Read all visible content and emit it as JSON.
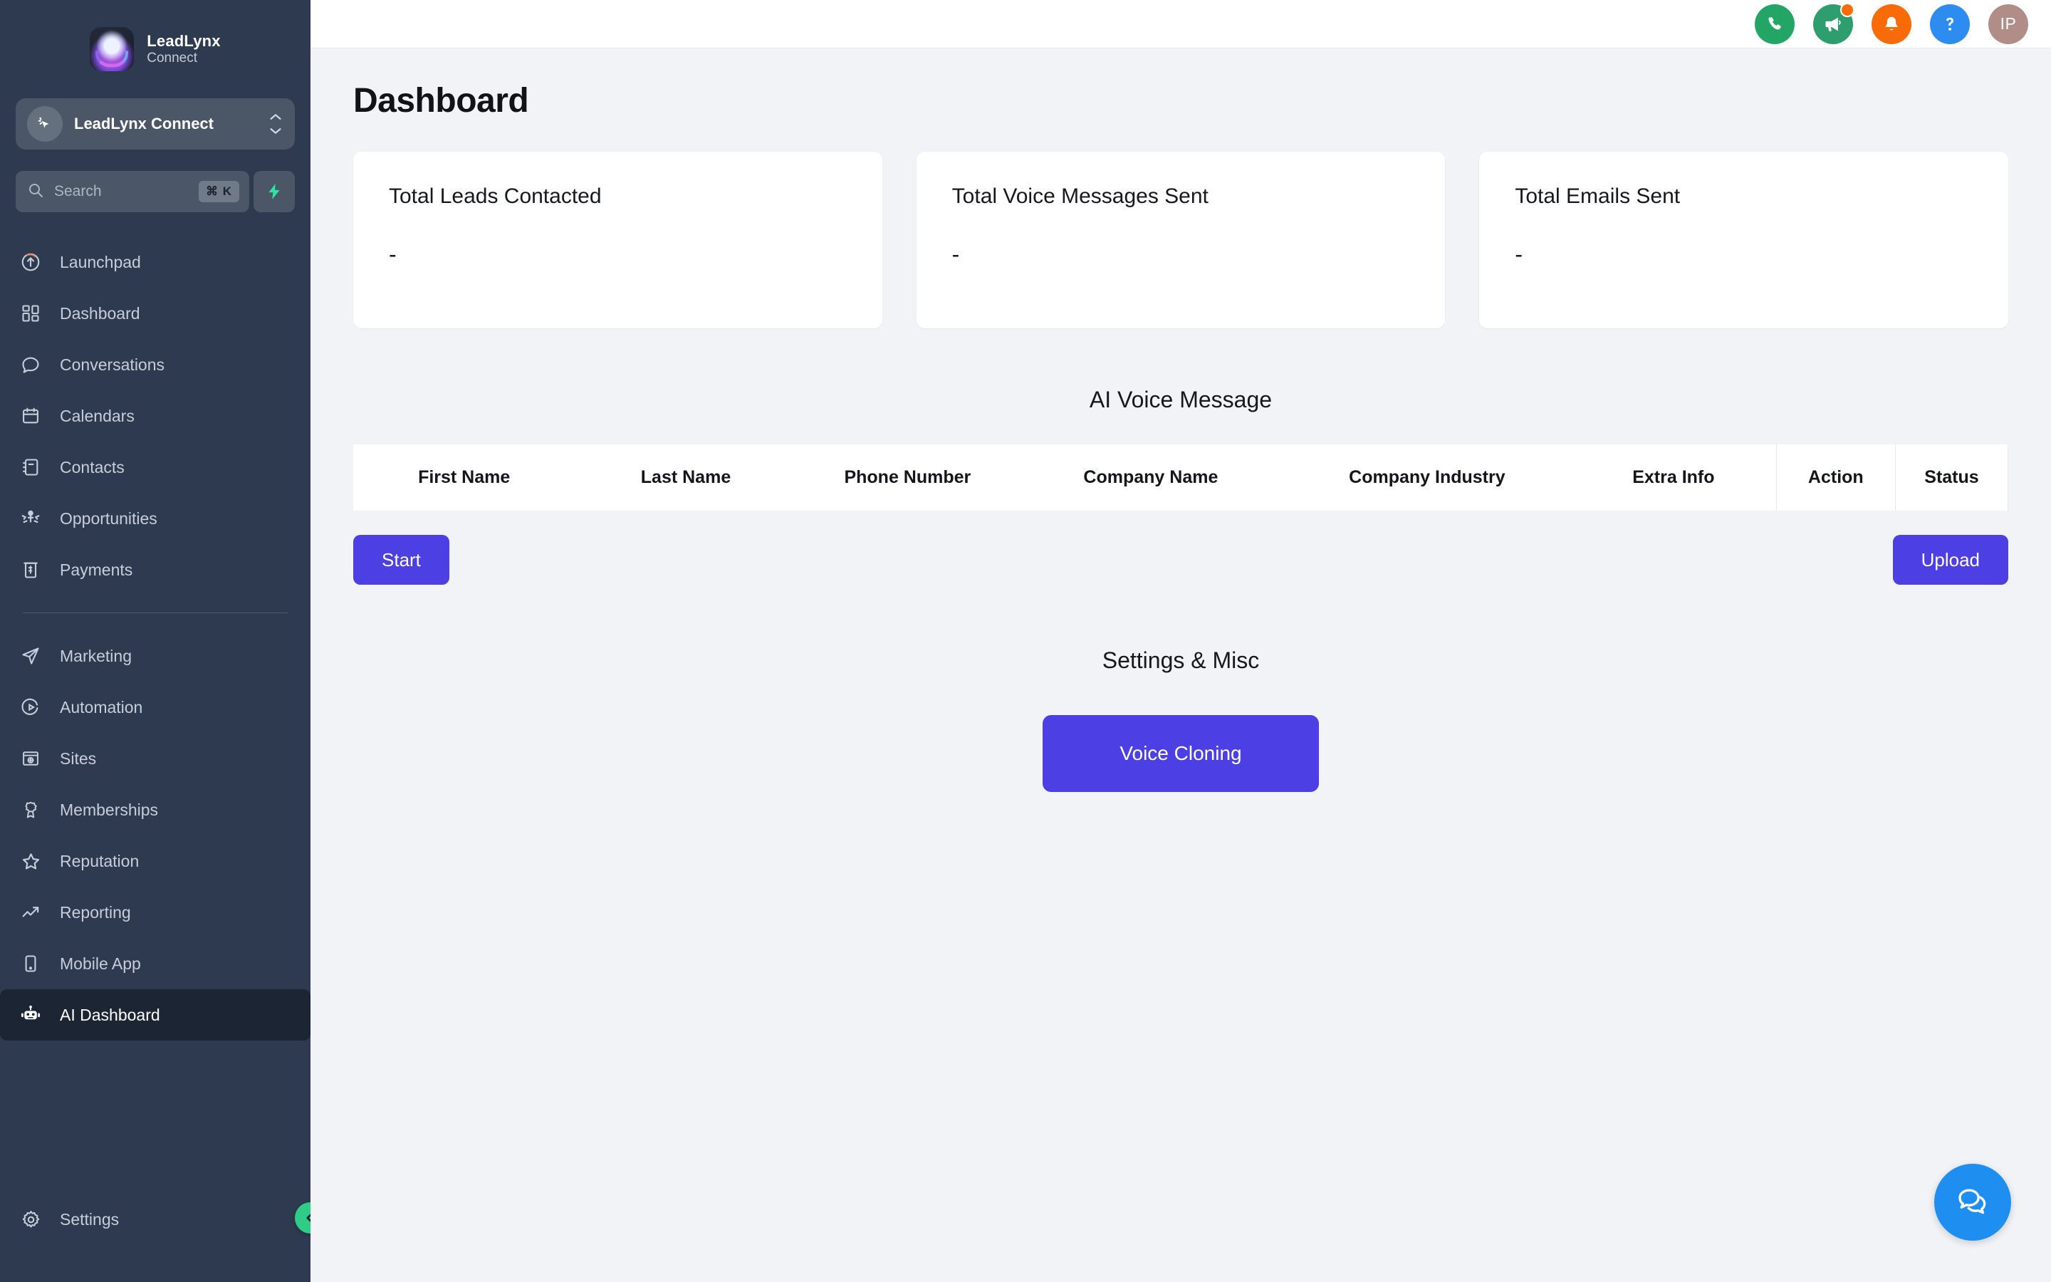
{
  "brand": {
    "name": "LeadLynx",
    "sub": "Connect",
    "logo_icon": "lynx-logo-icon"
  },
  "workspace": {
    "name": "LeadLynx Connect",
    "avatar_icon": "cursor-click-icon",
    "switcher_icon": "chevron-up-down-icon"
  },
  "search": {
    "placeholder": "Search",
    "shortcut": "⌘ K",
    "icon": "search-icon",
    "quick_action_icon": "lightning-bolt-icon"
  },
  "sidebar": {
    "items": [
      {
        "label": "Launchpad",
        "icon": "rocket-launch-icon",
        "active": false
      },
      {
        "label": "Dashboard",
        "icon": "grid-dashboard-icon",
        "active": false
      },
      {
        "label": "Conversations",
        "icon": "chat-bubble-icon",
        "active": false
      },
      {
        "label": "Calendars",
        "icon": "calendar-icon",
        "active": false
      },
      {
        "label": "Contacts",
        "icon": "address-book-icon",
        "active": false
      },
      {
        "label": "Opportunities",
        "icon": "opportunities-person-icon",
        "active": false
      },
      {
        "label": "Payments",
        "icon": "dollar-receipt-icon",
        "active": false
      }
    ],
    "items2": [
      {
        "label": "Marketing",
        "icon": "paper-plane-icon",
        "active": false
      },
      {
        "label": "Automation",
        "icon": "play-circle-icon",
        "active": false
      },
      {
        "label": "Sites",
        "icon": "browser-globe-icon",
        "active": false
      },
      {
        "label": "Memberships",
        "icon": "award-ribbon-icon",
        "active": false
      },
      {
        "label": "Reputation",
        "icon": "star-icon",
        "active": false
      },
      {
        "label": "Reporting",
        "icon": "trending-up-icon",
        "active": false
      },
      {
        "label": "Mobile App",
        "icon": "mobile-phone-icon",
        "active": false
      },
      {
        "label": "AI Dashboard",
        "icon": "robot-icon",
        "active": true
      }
    ],
    "settings": {
      "label": "Settings",
      "icon": "gear-icon"
    },
    "collapse_icon": "chevron-left-icon"
  },
  "topbar": {
    "icons": [
      {
        "name": "phone-icon",
        "color": "#23a566",
        "badge": false
      },
      {
        "name": "megaphone-icon",
        "color": "#2f9e6e",
        "badge": true
      },
      {
        "name": "bell-icon",
        "color": "#f96a09",
        "badge": false
      },
      {
        "name": "help-question-icon",
        "color": "#2d8cf0",
        "badge": false
      }
    ],
    "avatar_initials": "IP",
    "avatar_color": "#b08e87"
  },
  "page": {
    "title": "Dashboard"
  },
  "stats": [
    {
      "title": "Total Leads Contacted",
      "value": "-"
    },
    {
      "title": "Total Voice Messages Sent",
      "value": "-"
    },
    {
      "title": "Total Emails Sent",
      "value": "-"
    }
  ],
  "voice_section": {
    "title": "AI Voice Message",
    "columns": [
      "First Name",
      "Last Name",
      "Phone Number",
      "Company Name",
      "Company Industry",
      "Extra Info",
      "Action",
      "Status"
    ],
    "rows": [],
    "start_label": "Start",
    "upload_label": "Upload"
  },
  "misc_section": {
    "title": "Settings & Misc",
    "voice_cloning_label": "Voice Cloning"
  },
  "chat_widget": {
    "icon": "chat-bubbles-icon",
    "color": "#1f8ef1"
  },
  "colors": {
    "accent_purple": "#4c3fe4",
    "sidebar_bg": "#2d3a4f",
    "sidebar_active_bg": "#1c2533",
    "page_bg": "#f1f3f6",
    "green": "#2ecc87"
  }
}
